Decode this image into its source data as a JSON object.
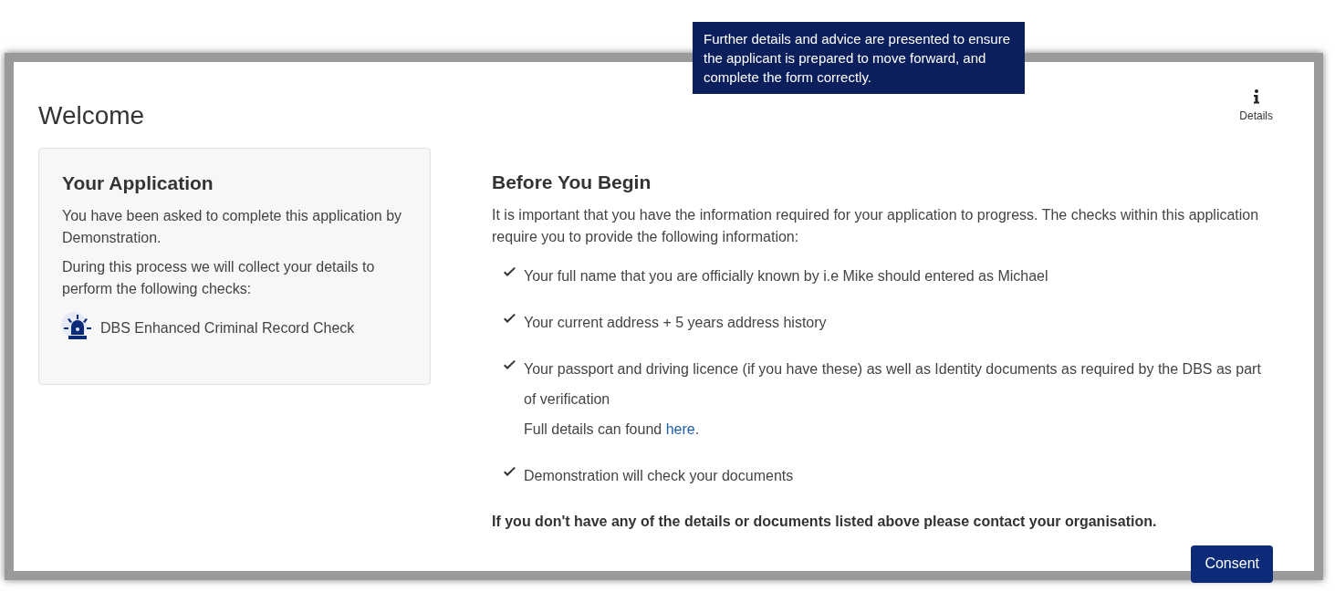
{
  "tooltip": "Further details and advice are presented to ensure the applicant is prepared to move forward, and complete the form correctly.",
  "page_title": "Welcome",
  "details_button": {
    "label": "Details"
  },
  "application": {
    "title": "Your Application",
    "paragraphs": [
      "You have been asked to complete this application by Demonstration.",
      "During this process we will collect your details to perform the following checks:"
    ],
    "checks": [
      "DBS Enhanced Criminal Record Check"
    ]
  },
  "before": {
    "title": "Before You Begin",
    "intro": "It is important that you have the information required for your application to progress. The checks within this application require you to provide the following information:",
    "items": [
      {
        "text": "Your full name that you are officially known by i.e Mike should entered as Michael"
      },
      {
        "text": "Your current address + 5 years address history"
      },
      {
        "text": "Your passport and driving licence (if you have these) as well as Identity documents as required by the DBS as part of verification",
        "note": {
          "before": "Full details can found ",
          "link": "here",
          "after": "."
        }
      },
      {
        "text": "Demonstration will check your documents"
      }
    ],
    "footer": "If you don't have any of the details or documents listed above please contact your organisation."
  },
  "consent_button": "Consent"
}
